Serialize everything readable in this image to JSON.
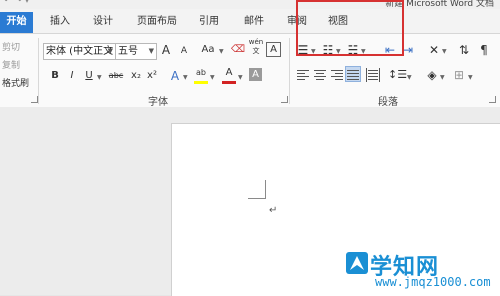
{
  "title_bar": {
    "document_title": "新建 Microsoft Word 文档"
  },
  "tabs": [
    {
      "label": "开始",
      "active": true
    },
    {
      "label": "插入"
    },
    {
      "label": "设计"
    },
    {
      "label": "页面布局"
    },
    {
      "label": "引用"
    },
    {
      "label": "邮件"
    },
    {
      "label": "审阅"
    },
    {
      "label": "视图"
    }
  ],
  "clipboard": {
    "cut": "剪切",
    "copy": "复制",
    "format_painter": "格式刷"
  },
  "font_group": {
    "label": "字体",
    "font_name": "宋体 (中文正文",
    "font_size": "五号",
    "grow": "A",
    "shrink": "A",
    "change_case": "Aa",
    "pinyin_top": "wén",
    "pinyin_bottom": "文",
    "bold": "B",
    "italic": "I",
    "underline": "U",
    "strikethrough": "abc",
    "subscript": "x₂",
    "superscript": "x²",
    "text_effects": "A",
    "highlight": "ab",
    "font_color": "A",
    "char_shading": "A",
    "font_color_value": "#d22222",
    "highlight_color_value": "#ffff00"
  },
  "paragraph_group": {
    "label": "段落"
  },
  "watermark": {
    "cn": "学知网",
    "url": "www.jmqz1000.com"
  },
  "document": {
    "paragraph_mark": "↵"
  }
}
